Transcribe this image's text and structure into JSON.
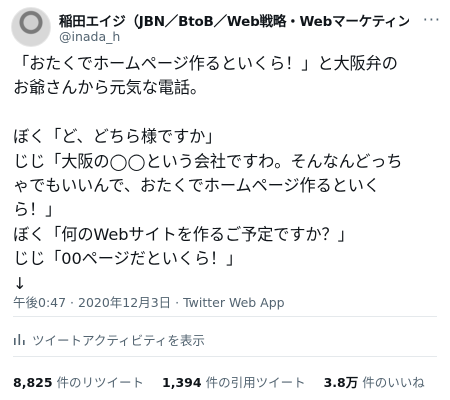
{
  "header": {
    "display_name": "稲田エイジ（JBN／BtoB／Web戦略・Webマーケティング・Hub...",
    "handle": "@inada_h",
    "more_icon": "more-dots-icon"
  },
  "body": {
    "lines": [
      "「おたくでホームページ作るといくら！」と大阪弁の",
      "お爺さんから元気な電話。",
      "",
      "ぼく「ど、どちら様ですか」",
      "じじ「大阪の◯◯という会社ですわ。そんなんどっち",
      "ゃでもいいんで、おたくでホームページ作るといく",
      "ら！」",
      "ぼく「何のWebサイトを作るご予定ですか？」",
      "じじ「00ページだといくら！」",
      "↓"
    ]
  },
  "meta": {
    "timestamp": "午後0:47 · 2020年12月3日 · Twitter Web App"
  },
  "activity": {
    "label": "ツイートアクティビティを表示",
    "icon": "bar-chart-icon"
  },
  "stats": [
    {
      "value": "8,825",
      "label": "件のリツイート"
    },
    {
      "value": "1,394",
      "label": "件の引用ツイート"
    },
    {
      "value": "3.8万",
      "label": "件のいいね"
    }
  ],
  "colors": {
    "text": "#0f1419",
    "secondary": "#536471",
    "divider": "#e5e9ec"
  }
}
